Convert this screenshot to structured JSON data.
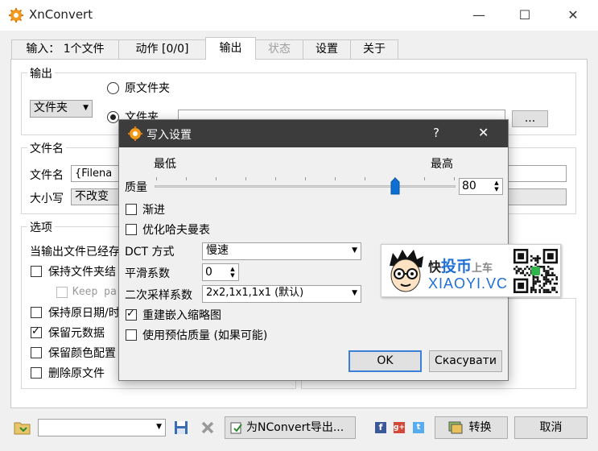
{
  "window": {
    "title": "XnConvert",
    "minimize": "—",
    "maximize": "☐",
    "close": "✕"
  },
  "tabs": [
    {
      "label": "输入： 1个文件"
    },
    {
      "label": "动作 [0/0]"
    },
    {
      "label": "输出"
    },
    {
      "label": "状态"
    },
    {
      "label": "设置"
    },
    {
      "label": "关于"
    }
  ],
  "output": {
    "group_label": "输出",
    "radio_original": "原文件夹",
    "radio_folder": "文件夹",
    "dest_type": "文件夹",
    "browse_label": "..."
  },
  "filename": {
    "group_label": "文件名",
    "name_label": "文件名",
    "name_value": "{Filena",
    "case_label": "大小写",
    "case_value": "不改变"
  },
  "options": {
    "group_label": "选项",
    "if_exists_label": "当输出文件已经存",
    "items": [
      {
        "label": "保持文件夹结",
        "checked": false
      },
      {
        "label": "Keep pa",
        "checked": false
      },
      {
        "label": "保持原日期/时",
        "checked": false
      },
      {
        "label": "保留元数据",
        "checked": true
      },
      {
        "label": "保留颜色配置",
        "checked": false
      },
      {
        "label": "删除原文件",
        "checked": false
      }
    ]
  },
  "dialog": {
    "title": "写入设置",
    "help": "?",
    "close": "✕",
    "min_label": "最低",
    "max_label": "最高",
    "quality_label": "质量",
    "quality_value": "80",
    "quality_fraction": 0.8,
    "progressive_label": "渐进",
    "progressive_checked": false,
    "huffman_label": "优化哈夫曼表",
    "huffman_checked": false,
    "dct_label": "DCT 方式",
    "dct_value": "慢速",
    "smooth_label": "平滑系数",
    "smooth_value": "0",
    "subsample_label": "二次采样系数",
    "subsample_value": "2x2,1x1,1x1 (默认)",
    "rebuild_thumb_label": "重建嵌入缩略图",
    "rebuild_thumb_checked": true,
    "estimate_label": "使用预估质量 (如果可能)",
    "estimate_checked": false,
    "ok_label": "OK",
    "cancel_label": "Скасувати"
  },
  "watermark": {
    "text_cn_1": "快",
    "text_cn_2": "投币",
    "text_cn_3": "上车",
    "text_en": "XIAOYI.VC"
  },
  "bottom": {
    "export_label": "为NConvert导出...",
    "convert_label": "转换",
    "close_label": "取消"
  }
}
